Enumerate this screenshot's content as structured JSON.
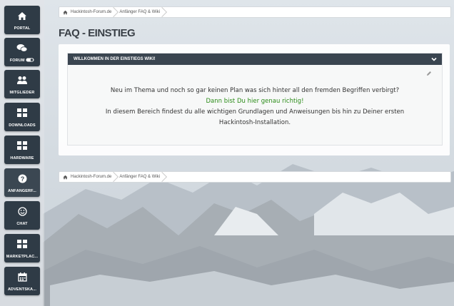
{
  "sidebar": {
    "items": [
      {
        "label": "PORTAL",
        "icon": "home-icon"
      },
      {
        "label": "FORUM",
        "icon": "chat-bubbles-icon",
        "badge_icon": "toggle-icon"
      },
      {
        "label": "MITGLIEDER",
        "icon": "users-icon"
      },
      {
        "label": "DOWNLOADS",
        "icon": "grid-icon"
      },
      {
        "label": "HARDWARE",
        "icon": "grid-icon"
      },
      {
        "label": "ANFÄNGERF...",
        "icon": "question-circle-icon",
        "active": true
      },
      {
        "label": "CHAT",
        "icon": "smiley-icon"
      },
      {
        "label": "MARKETPLAC...",
        "icon": "grid-icon"
      },
      {
        "label": "ADVENTSKA...",
        "icon": "calendar-icon"
      }
    ]
  },
  "breadcrumb": {
    "items": [
      "Hackintosh-Forum.de",
      "Anfänger FAQ & Wiki"
    ]
  },
  "page": {
    "title": "FAQ - EINSTIEG"
  },
  "box": {
    "header": "WILLKOMMEN IN DER EINSTIEGS WIKI!",
    "line1": "Neu im Thema und noch so gar keinen Plan was sich hinter all den fremden Begriffen verbirgt?",
    "line2": "Dann bist Du hier genau richtig!",
    "line3": "In diesem Bereich findest du alle wichtigen Grundlagen und Anweisungen bis hin zu Deiner ersten",
    "line4": "Hackintosh-Installation."
  },
  "colors": {
    "sidebar_tile": "#2f3b46",
    "box_header": "#3a4550",
    "highlight_text": "#2a8b17"
  }
}
